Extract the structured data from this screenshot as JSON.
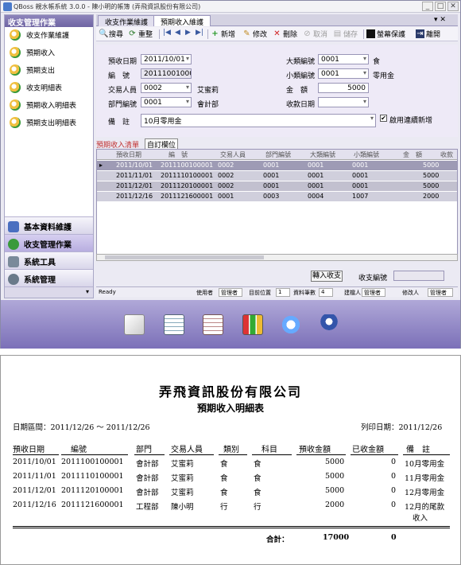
{
  "window": {
    "title": "QBoss 親水帳系統 3.0.0 - 陳小明的帳簿 (弄飛資訊股份有限公司)",
    "min": "_",
    "max": "□",
    "close": "✕"
  },
  "sidebar": {
    "header": "收支管理作業",
    "items": [
      "收支作業維護",
      "預期收入",
      "預期支出",
      "收支明細表",
      "預期收入明細表",
      "預期支出明細表"
    ],
    "groups": [
      "基本資料維護",
      "收支管理作業",
      "系統工具",
      "系統管理"
    ]
  },
  "tabs": [
    "收支作業維護",
    "預期收入維護"
  ],
  "toolbar": {
    "search": "搜尋",
    "reset": "重整",
    "add": "新增",
    "edit": "修改",
    "delete": "刪除",
    "cancel": "取消",
    "save": "儲存",
    "screensaver": "螢幕保護",
    "close": "離開",
    "pin": "▾ ✕"
  },
  "form": {
    "date_label": "預收日期",
    "date": "2011/10/01",
    "no_label": "編　號",
    "no": "2011100100001",
    "person_label": "交易人員",
    "person_code": "0002",
    "person_name": "艾蜜莉",
    "dept_label": "部門編號",
    "dept_code": "0001",
    "dept_name": "會計部",
    "remark_label": "備　註",
    "remark": "10月零用金",
    "cat_label": "大類編號",
    "cat_code": "0001",
    "cat_name": "食",
    "sub_label": "小類編號",
    "sub_code": "0001",
    "sub_name": "零用金",
    "amount_label": "金　額",
    "amount": "5000",
    "recv_label": "收款日期",
    "recv": "",
    "continuous_label": "啟用連續新增",
    "continuous_check": "✔"
  },
  "grid": {
    "tab1": "預期收入清單",
    "tab2": "自訂欄位",
    "headers": [
      "預收日期",
      "編　號",
      "交易人員",
      "部門編號",
      "大類編號",
      "小類編號",
      "金　額",
      "收款"
    ],
    "rows": [
      [
        "2011/10/01",
        "2011100100001",
        "0002",
        "0001",
        "0001",
        "0001",
        "5000"
      ],
      [
        "2011/11/01",
        "2011110100001",
        "0002",
        "0001",
        "0001",
        "0001",
        "5000"
      ],
      [
        "2011/12/01",
        "2011120100001",
        "0002",
        "0001",
        "0001",
        "0001",
        "5000"
      ],
      [
        "2011/12/16",
        "2011121600001",
        "0001",
        "0003",
        "0004",
        "1007",
        "2000"
      ]
    ]
  },
  "bottom": {
    "transfer": "轉入收支",
    "income_no_label": "收支編號",
    "income_no": ""
  },
  "status": {
    "ready": "Ready",
    "user_label": "使用者",
    "user": "管理者",
    "pos_label": "目前位置",
    "pos": "1",
    "count_label": "資料筆數",
    "count": "4",
    "creator_label": "建檔人",
    "creator": "管理者",
    "modifier_label": "修改人",
    "modifier": "管理者"
  },
  "report": {
    "company": "弄飛資訊股份有限公司",
    "title": "預期收入明細表",
    "range": "日期區間：2011/12/26 ～ 2011/12/26",
    "print_date": "列印日期：2011/12/26",
    "headers": [
      "預收日期",
      "編號",
      "部門",
      "交易人員",
      "類別",
      "科目",
      "預收金額",
      "已收金額",
      "備　註"
    ],
    "rows": [
      [
        "2011/10/01",
        "2011100100001",
        "會計部",
        "艾蜜莉",
        "食",
        "食",
        "5000",
        "0",
        "10月零用金"
      ],
      [
        "2011/11/01",
        "2011110100001",
        "會計部",
        "艾蜜莉",
        "食",
        "食",
        "5000",
        "0",
        "11月零用金"
      ],
      [
        "2011/12/01",
        "2011120100001",
        "會計部",
        "艾蜜莉",
        "食",
        "食",
        "5000",
        "0",
        "12月零用金"
      ],
      [
        "2011/12/16",
        "2011121600001",
        "工程部",
        "陳小明",
        "行",
        "行",
        "2000",
        "0",
        "12月的尾款"
      ]
    ],
    "last_note_line2": "收入",
    "total_label": "合計：",
    "total_recv": "17000",
    "total_paid": "0"
  },
  "colors": {
    "accent": "#7b70b8",
    "selected": "#9e9bb5"
  }
}
